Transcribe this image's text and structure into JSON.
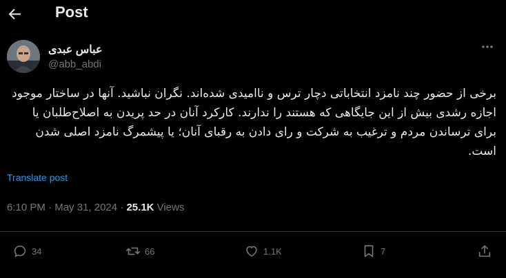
{
  "header": {
    "title": "Post",
    "back_icon": "arrow-left-icon"
  },
  "author": {
    "name": "عباس عبدی",
    "handle": "@abb_abdi"
  },
  "post": {
    "text": "برخی از حضور چند نامزد انتخاباتی دچار ترس و ناامیدی شده‌اند. نگران نباشید. آنها در ساختار موجود اجازه رشدی بیش از این جایگاهی که هستند را ندارند. کارکرد آنان در حد پریدن به اصلاح‌طلبان یا برای ترساندن مردم و ترغیب به شرکت و رای دادن به رقبای آنان؛ یا پیشمرگ نامزد اصلی شدن است.",
    "translate_label": "Translate post"
  },
  "meta": {
    "time": "6:10 PM",
    "date": "May 31, 2024",
    "views_count": "25.1K",
    "views_label": "Views"
  },
  "actions": {
    "replies": "34",
    "reposts": "66",
    "likes": "1.1K",
    "bookmarks": "7"
  },
  "colors": {
    "background": "#000000",
    "text": "#e7e9ea",
    "muted": "#71767b",
    "link": "#1d9bf0"
  }
}
